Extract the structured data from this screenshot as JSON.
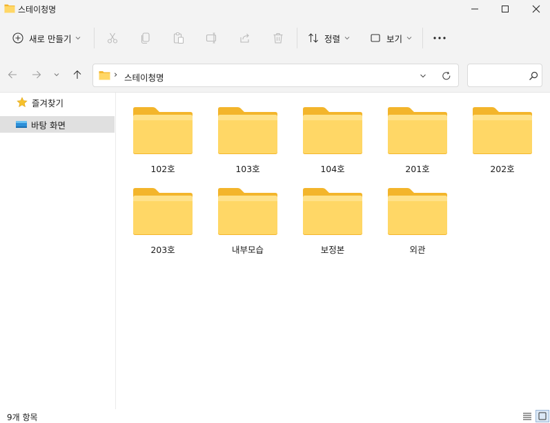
{
  "window": {
    "title": "스테이청명",
    "colors": {
      "chrome": "#f3f3f3",
      "folder_back": "#f3b52b",
      "folder_front": "#ffd766",
      "selection": "#e0e0e0"
    }
  },
  "toolbar": {
    "new_label": "새로 만들기",
    "sort_label": "정렬",
    "view_label": "보기",
    "icons": [
      "cut-icon",
      "copy-icon",
      "paste-icon",
      "rename-icon",
      "share-icon",
      "delete-icon"
    ]
  },
  "address": {
    "path": "스테이청명",
    "separator": "›"
  },
  "search": {
    "placeholder": ""
  },
  "sidebar": {
    "items": [
      {
        "label": "즐겨찾기",
        "icon": "star-icon",
        "selected": false
      },
      {
        "label": "바탕 화면",
        "icon": "desktop-icon",
        "selected": true
      }
    ]
  },
  "folders": [
    {
      "name": "102호"
    },
    {
      "name": "103호"
    },
    {
      "name": "104호"
    },
    {
      "name": "201호"
    },
    {
      "name": "202호"
    },
    {
      "name": "203호"
    },
    {
      "name": "내부모습"
    },
    {
      "name": "보정본"
    },
    {
      "name": "외관"
    }
  ],
  "status": {
    "item_count": "9개 항목"
  }
}
